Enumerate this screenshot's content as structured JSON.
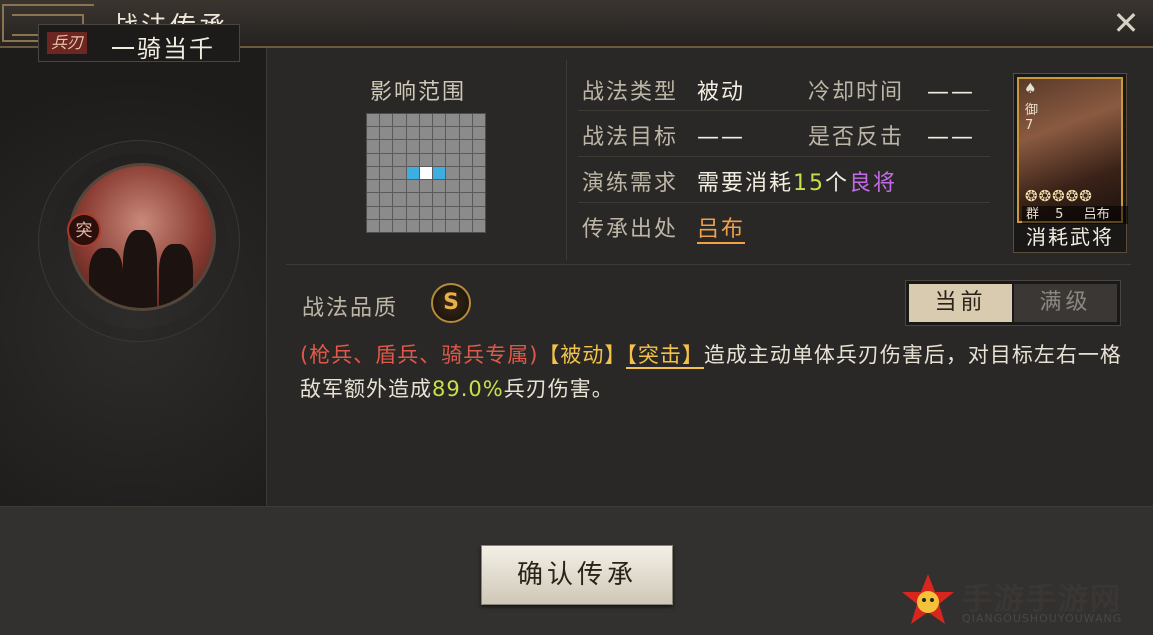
{
  "window": {
    "title": "战法传承"
  },
  "skill": {
    "type_tag": "兵刃",
    "name": "一骑当千",
    "badge": "突"
  },
  "range": {
    "label": "影响范围",
    "rows": 9,
    "cols": 9,
    "hit_cells": [
      [
        4,
        3
      ],
      [
        4,
        5
      ]
    ],
    "self_cell": [
      4,
      4
    ],
    "colors": {
      "cell": "#8b8b8b",
      "hit": "#3eaee0",
      "self": "#ffffff"
    }
  },
  "info": {
    "type_label": "战法类型",
    "type_value": "被动",
    "cooldown_label": "冷却时间",
    "cooldown_value": "——",
    "target_label": "战法目标",
    "target_value": "——",
    "counter_label": "是否反击",
    "counter_value": "——",
    "drill_label": "演练需求",
    "drill_prefix": "需要消耗",
    "drill_count": "15",
    "drill_unit": "个",
    "drill_quality": "良将",
    "source_label": "传承出处",
    "source_value": "吕布"
  },
  "card": {
    "cost_label": "御",
    "cost_value": "7",
    "stars": "❂❂❂❂❂",
    "faction": "群",
    "level": "5",
    "general": "吕布",
    "caption": "消耗武将"
  },
  "quality": {
    "label": "战法品质",
    "grade": "S"
  },
  "toggle": {
    "current": "当前",
    "max": "满级"
  },
  "description": {
    "troops": "(枪兵、盾兵、骑兵专属)",
    "tag1": "【被动】",
    "tag2": "【突击】",
    "text1": "造成主动单体兵刃伤害后，对目标左右一格敌军额外造成",
    "percent": "89.0%",
    "text2": "兵刃伤害。"
  },
  "actions": {
    "confirm": "确认传承"
  },
  "watermark": {
    "text": "手游手游网",
    "sub": "QIANGOUSHOUYOUWANG"
  }
}
